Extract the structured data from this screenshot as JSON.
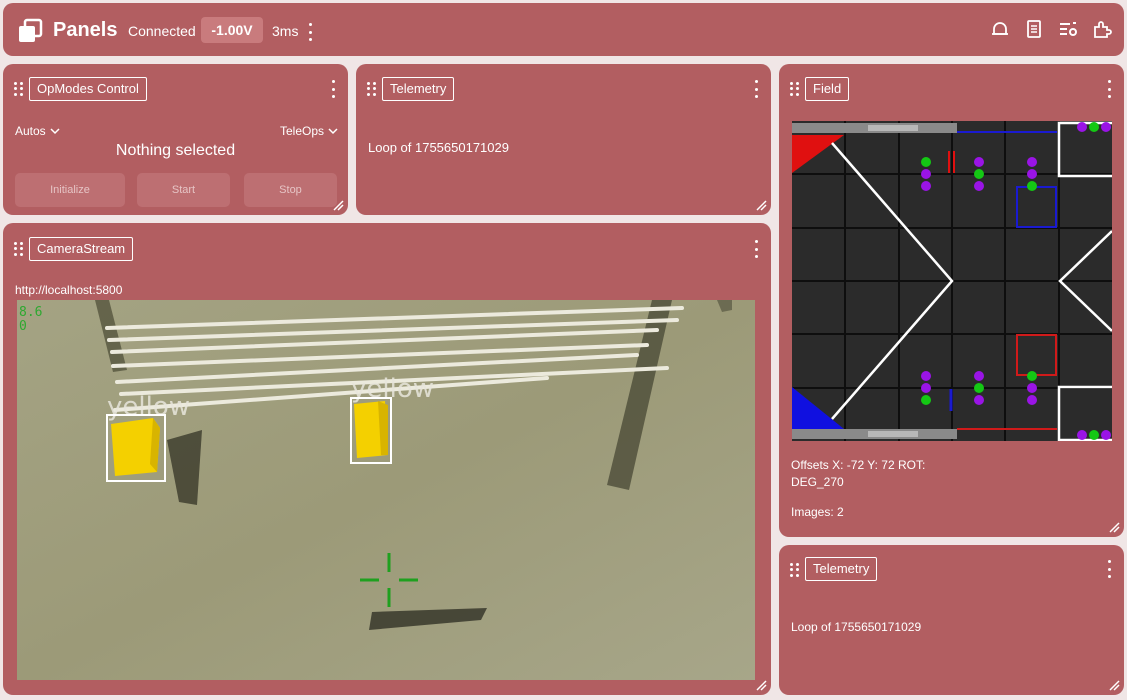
{
  "header": {
    "app_title": "Panels",
    "status": "Connected",
    "voltage": "-1.00V",
    "latency": "3ms",
    "icons": [
      "bell-icon",
      "document-icon",
      "list-settings-icon",
      "plugin-icon"
    ]
  },
  "opmodes": {
    "title": "OpModes Control",
    "autos_label": "Autos",
    "teleops_label": "TeleOps",
    "selection": "Nothing selected",
    "init_label": "Initialize",
    "start_label": "Start",
    "stop_label": "Stop"
  },
  "telemetry_top": {
    "title": "Telemetry",
    "text": "Loop of 1755650171029"
  },
  "camera": {
    "title": "CameraStream",
    "url": "http://localhost:5800",
    "overlay_numbers": [
      "8.6",
      "0"
    ],
    "detections": [
      "yellow",
      "yellow"
    ]
  },
  "field": {
    "title": "Field",
    "offsets": "Offsets X: -72 Y: 72 ROT: DEG_270",
    "images": "Images: 2"
  },
  "telemetry_bottom": {
    "title": "Telemetry",
    "text": "Loop of 1755650171029"
  },
  "colors": {
    "panel": "#b25e61",
    "background": "#f0e6e6",
    "field_tile": "#2b2b2b",
    "red_alliance": "#e01010",
    "blue_alliance": "#1010e0",
    "sample_yellow": "#f4d000"
  }
}
